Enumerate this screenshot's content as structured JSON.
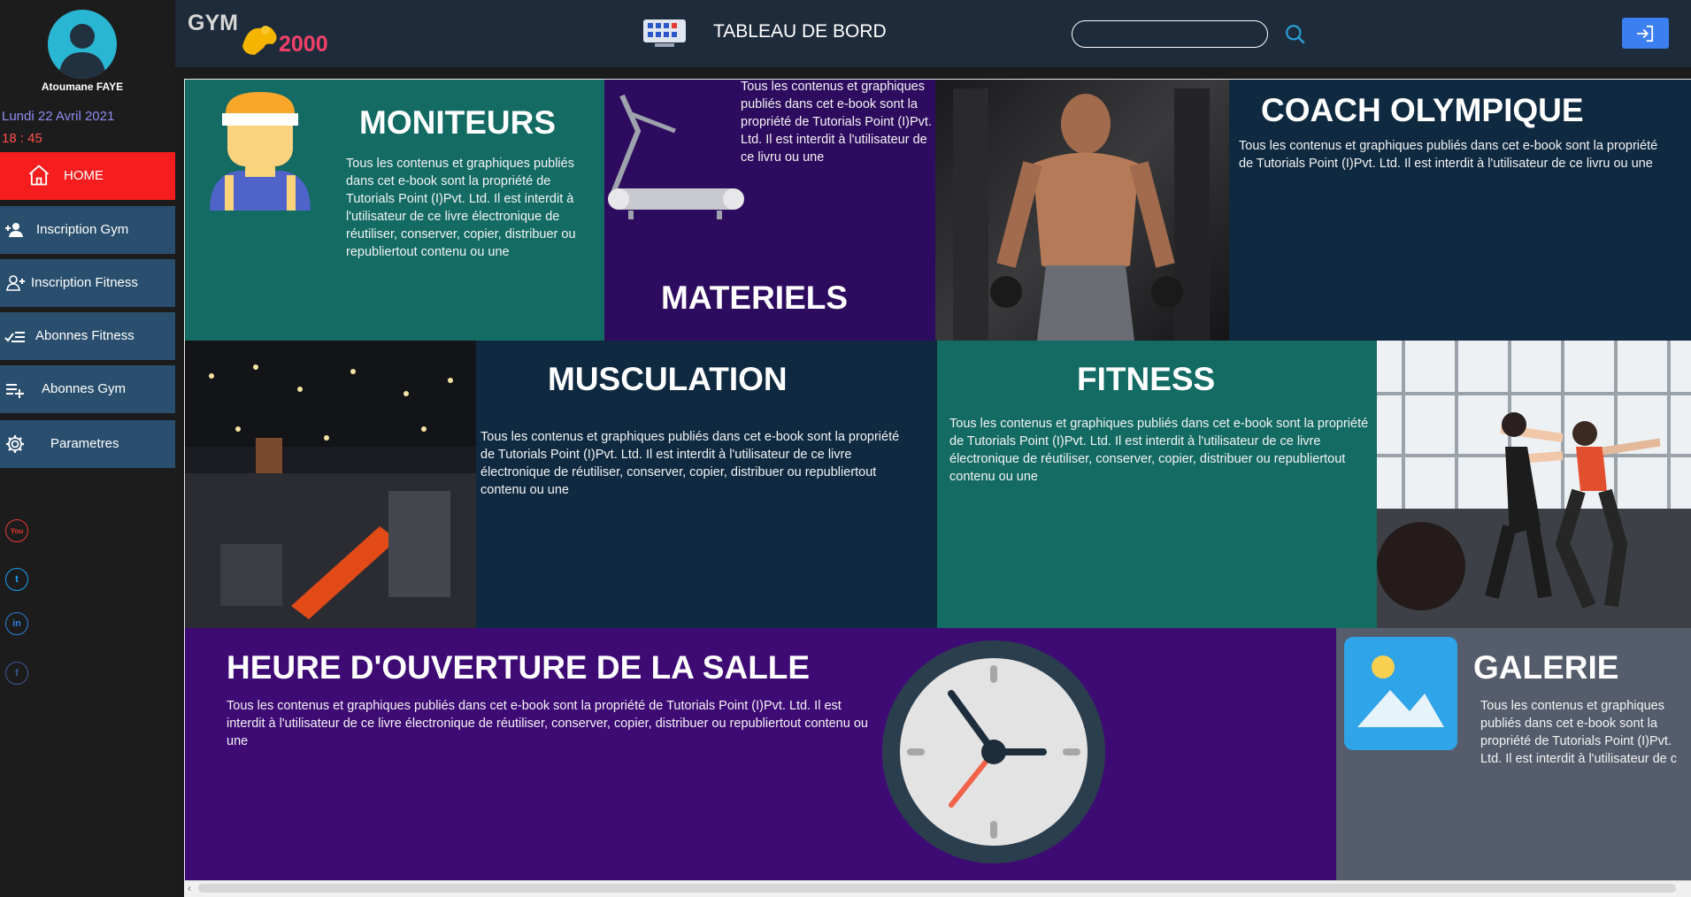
{
  "user": {
    "name": "Atoumane FAYE",
    "date": "Lundi 22 Avril 2021",
    "time": "18 : 45"
  },
  "nav": [
    {
      "label": "HOME",
      "icon": "home-icon",
      "active": true
    },
    {
      "label": "Inscription Gym",
      "icon": "user-add-icon"
    },
    {
      "label": "Inscription Fitness",
      "icon": "user-add-outline-icon"
    },
    {
      "label": "Abonnes Fitness",
      "icon": "checklist-icon"
    },
    {
      "label": "Abonnes Gym",
      "icon": "playlist-add-icon"
    },
    {
      "label": "Parametres",
      "icon": "gear-icon"
    }
  ],
  "social": [
    {
      "icon": "youtube-icon",
      "glyph": "You",
      "color": "#e53935"
    },
    {
      "icon": "twitter-icon",
      "glyph": "t",
      "color": "#1da1f2"
    },
    {
      "icon": "linkedin-icon",
      "glyph": "in",
      "color": "#2d7fd6"
    },
    {
      "icon": "facebook-icon",
      "glyph": "f",
      "color": "#3b5998"
    }
  ],
  "header": {
    "logo_gym": "GYM",
    "logo_num": "2000",
    "title": "TABLEAU DE BORD",
    "search_placeholder": ""
  },
  "lorem": "Tous les contenus et graphiques publiés dans cet e-book sont la propriété de Tutorials Point (I)Pvt. Ltd. Il est interdit à l'utilisateur de ce livre électronique de réutiliser, conserver, copier, distribuer ou republiertout contenu ou une",
  "panels": {
    "moniteurs": {
      "title": "MONITEURS",
      "text": "Tous les contenus et graphiques publiés dans cet e-book sont la propriété de Tutorials Point (I)Pvt. Ltd. Il est interdit à l'utilisateur de ce livre électronique de réutiliser, conserver, copier, distribuer ou republiertout contenu ou une"
    },
    "materiels": {
      "title": "MATERIELS",
      "text": "Tous les contenus et graphiques publiés dans cet e-book sont la propriété de Tutorials Point (I)Pvt. Ltd. Il est interdit à l'utilisateur de ce livru ou une"
    },
    "coach": {
      "title": "COACH OLYMPIQUE",
      "text": "Tous les contenus et graphiques publiés dans cet e-book sont la propriété de Tutorials Point (I)Pvt. Ltd. Il est interdit à l'utilisateur de ce livru ou une"
    },
    "musculation": {
      "title": "MUSCULATION",
      "text": "Tous les contenus et graphiques publiés dans cet e-book sont la propriété de Tutorials Point (I)Pvt. Ltd. Il est interdit à l'utilisateur de ce livre électronique de réutiliser, conserver, copier, distribuer ou republiertout contenu ou une"
    },
    "fitness": {
      "title": "FITNESS",
      "text": "Tous les contenus et graphiques publiés dans cet e-book sont la propriété de Tutorials Point (I)Pvt. Ltd. Il est interdit à l'utilisateur de ce livre électronique de réutiliser, conserver, copier, distribuer ou republiertout contenu ou une"
    },
    "heure": {
      "title": "HEURE D'OUVERTURE DE LA SALLE",
      "text": "Tous les contenus et graphiques publiés dans cet e-book sont la propriété de Tutorials Point (I)Pvt. Ltd. Il est interdit à l'utilisateur de ce livre électronique de réutiliser, conserver, copier, distribuer ou republiertout contenu ou une"
    },
    "galerie": {
      "title": "GALERIE",
      "text": "Tous les contenus et graphiques publiés dans cet e-book sont la propriété de Tutorials Point (I)Pvt. Ltd. Il est interdit à l'utilisateur de c"
    }
  },
  "colors": {
    "teal": "#136b63",
    "navy": "#0f2940",
    "purple": "#3a0b6a",
    "slate": "#555c6b",
    "accent_red": "#f51d1d",
    "nav_blue": "#2a4f6e"
  }
}
